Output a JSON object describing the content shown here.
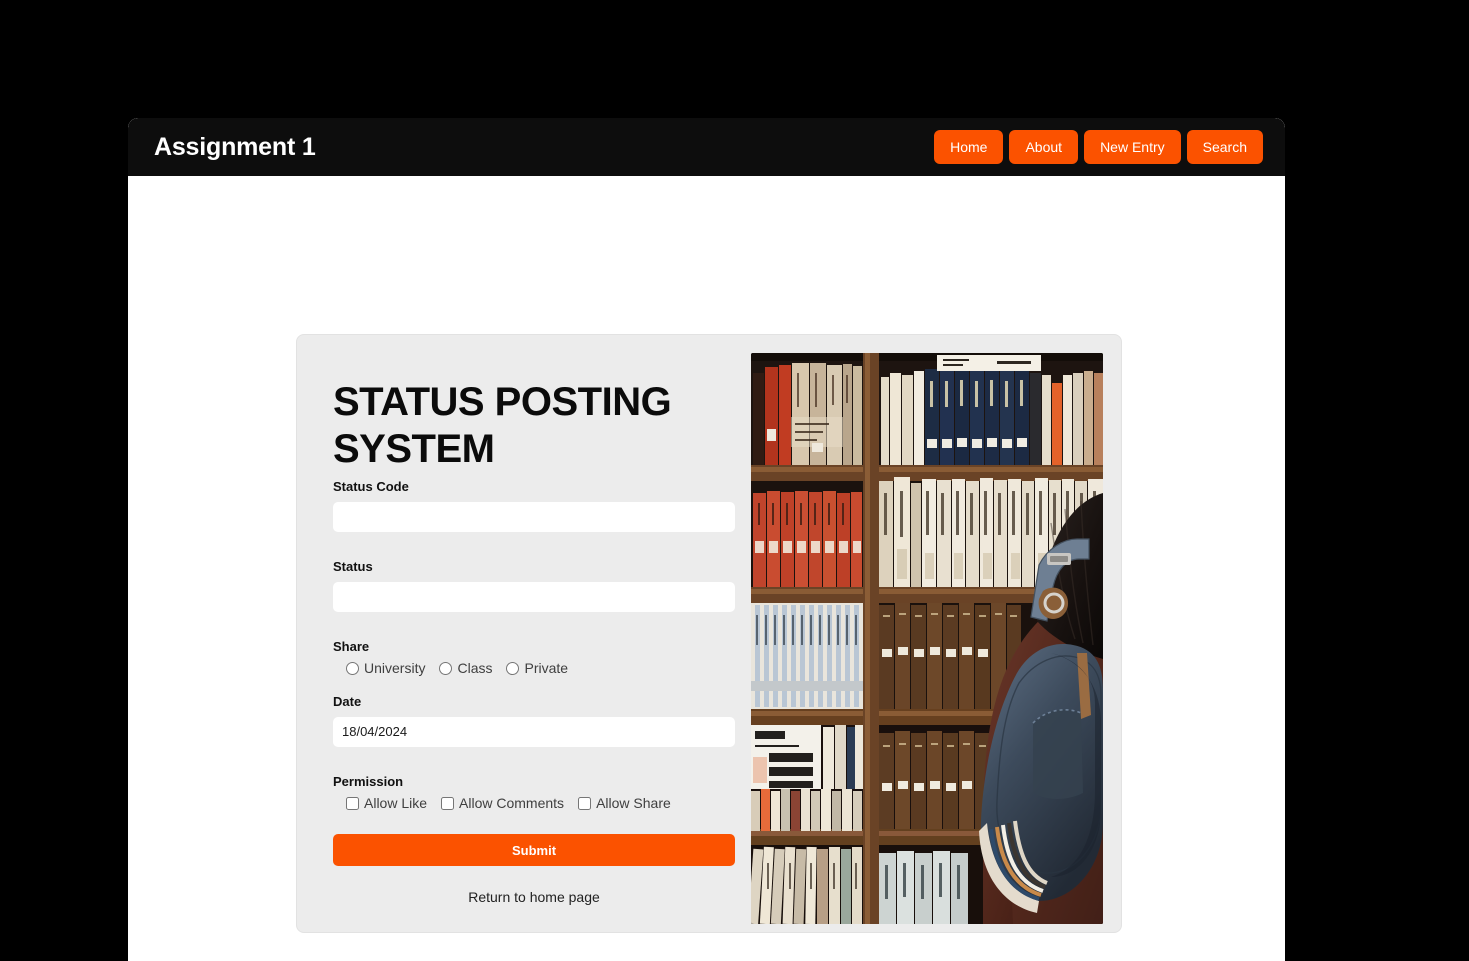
{
  "navbar": {
    "brand": "Assignment 1",
    "links": [
      {
        "label": "Home",
        "name": "nav-home"
      },
      {
        "label": "About",
        "name": "nav-about"
      },
      {
        "label": "New Entry",
        "name": "nav-new-entry"
      },
      {
        "label": "Search",
        "name": "nav-search"
      }
    ],
    "background_color": "#0d0d0d",
    "button_color": "#fb5200"
  },
  "form": {
    "title": "STATUS POSTING SYSTEM",
    "status_code": {
      "label": "Status Code",
      "value": "",
      "placeholder": ""
    },
    "status": {
      "label": "Status",
      "value": "",
      "placeholder": ""
    },
    "share": {
      "label": "Share",
      "options": [
        {
          "label": "University",
          "checked": false
        },
        {
          "label": "Class",
          "checked": false
        },
        {
          "label": "Private",
          "checked": false
        }
      ]
    },
    "date": {
      "label": "Date",
      "value": "18/04/2024"
    },
    "permission": {
      "label": "Permission",
      "options": [
        {
          "label": "Allow Like",
          "checked": false
        },
        {
          "label": "Allow Comments",
          "checked": false
        },
        {
          "label": "Allow Share",
          "checked": false
        }
      ]
    },
    "submit_label": "Submit",
    "home_link_label": "Return to home page",
    "card_background": "#ececec",
    "accent_color": "#fb5200"
  },
  "photo": {
    "name": "bookshelf-photo",
    "description": "Person with denim shoulder bag browsing a wooden bookshelf filled with Japanese books"
  }
}
